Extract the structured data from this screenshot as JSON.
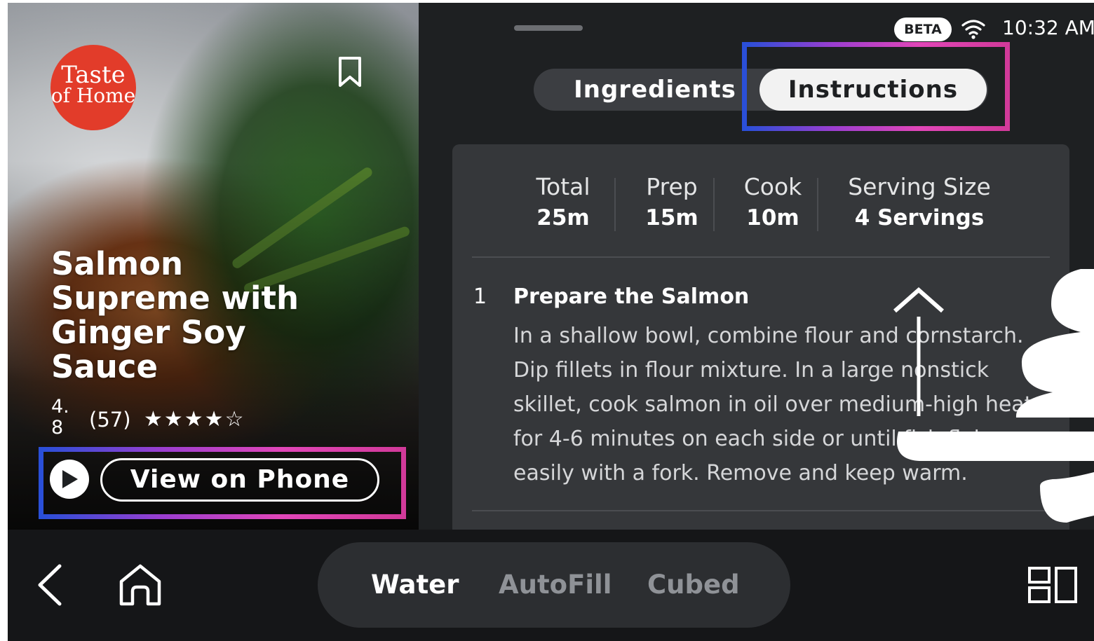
{
  "brand": {
    "line1": "Taste",
    "line2": "of Home"
  },
  "recipe": {
    "title": "Salmon Supreme with Ginger Soy Sauce",
    "rating_score": "4.\n8",
    "rating_count": "(57)",
    "stars": "★★★★☆",
    "view_on_phone_label": "View on Phone"
  },
  "status_bar": {
    "beta_label": "BETA",
    "time": "10:32 AM"
  },
  "tabs": [
    {
      "label": "Ingredients",
      "selected": false
    },
    {
      "label": "Instructions",
      "selected": true
    }
  ],
  "stats": [
    {
      "label": "Total",
      "value": "25m"
    },
    {
      "label": "Prep",
      "value": "15m"
    },
    {
      "label": "Cook",
      "value": "10m"
    },
    {
      "label": "Serving Size",
      "value": "4 Servings"
    }
  ],
  "steps": [
    {
      "number": "1",
      "title": "Prepare the Salmon",
      "body": "In a shallow bowl, combine flour and cornstarch. Dip fillets in flour mixture. In a large nonstick skillet, cook salmon in oil over medium-high heat for 4-6 minutes on each side or until fish flakes easily with a fork. Remove and keep warm."
    }
  ],
  "bottom_bar": {
    "modes": [
      {
        "label": "Water",
        "active": true
      },
      {
        "label": "AutoFill",
        "active": false
      },
      {
        "label": "Cubed",
        "active": false
      }
    ]
  },
  "icons": {
    "bookmark": "bookmark-icon",
    "play": "play-icon",
    "wifi": "wifi-icon",
    "back": "back-icon",
    "home": "home-icon",
    "grid": "recent-apps-icon",
    "gesture": "swipe-up-hand-icon"
  },
  "colors": {
    "screen_bg": "#1e2022",
    "brand_red": "#e23c2a",
    "highlight_gradient": [
      "#2a4fd8",
      "#9b3ed0",
      "#e146b8"
    ],
    "inactive_mode": "#8f9297"
  }
}
